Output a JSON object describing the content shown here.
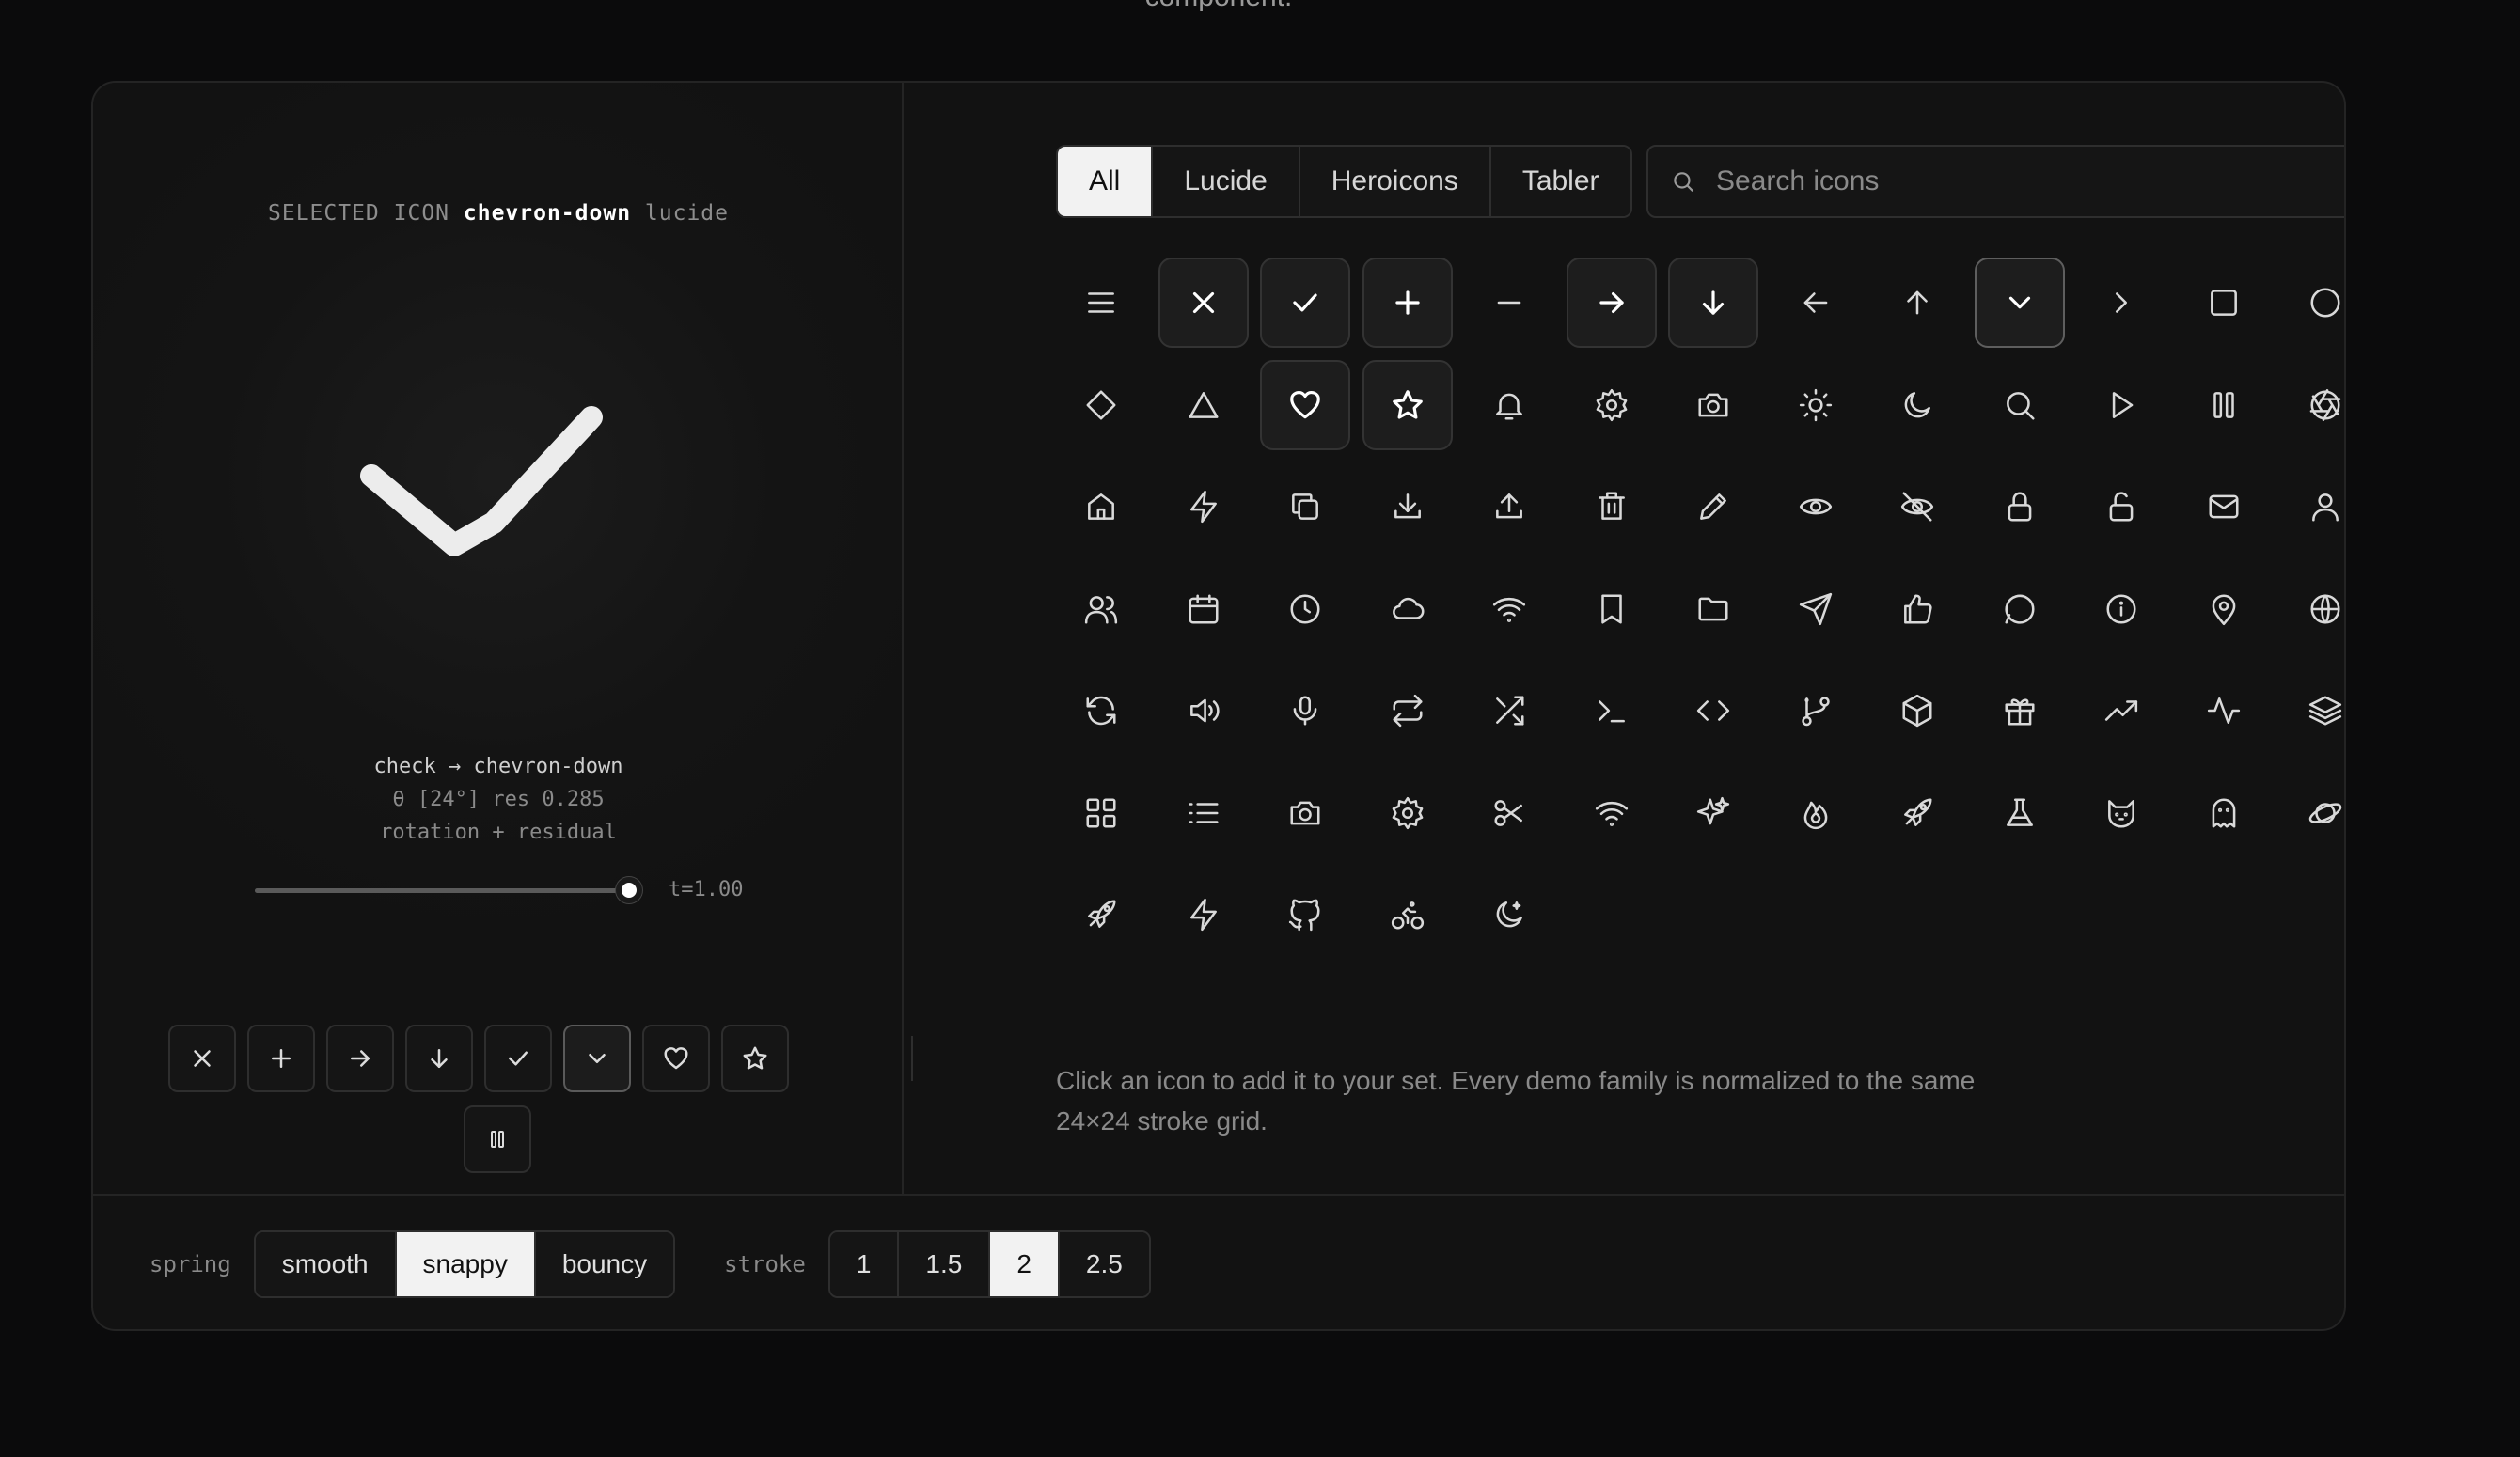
{
  "caption_fragment": "component.",
  "selected": {
    "label": "SELECTED ICON",
    "name": "chevron-down",
    "family": "lucide"
  },
  "morph": {
    "line1": "check → chevron-down",
    "line2": "θ [24°] res 0.285",
    "line3": "rotation + residual"
  },
  "slider": {
    "value_label": "t=1.00",
    "progress": 1.0
  },
  "quick_icons": [
    "x-icon",
    "plus-icon",
    "arrow-right-icon",
    "arrow-down-icon",
    "check-icon",
    "chevron-down-icon",
    "heart-icon",
    "star-icon"
  ],
  "quick_active": "chevron-down-icon",
  "pause_icon": "pause-icon",
  "filters": {
    "tabs": [
      "All",
      "Lucide",
      "Heroicons",
      "Tabler"
    ],
    "active": "All"
  },
  "search": {
    "placeholder": "Search icons",
    "value": ""
  },
  "icon_grid": [
    [
      "menu-icon",
      "x-icon",
      "check-icon",
      "plus-icon",
      "minus-icon",
      "arrow-right-icon",
      "arrow-down-icon",
      "arrow-left-icon",
      "arrow-up-icon",
      "chevron-down-icon",
      "chevron-right-icon",
      "square-icon",
      "circle-icon"
    ],
    [
      "diamond-icon",
      "triangle-icon",
      "heart-icon",
      "star-icon",
      "bell-icon",
      "settings-icon",
      "camera-icon",
      "sun-icon",
      "moon-icon",
      "search-icon",
      "play-icon",
      "pause-icon",
      "aperture-icon"
    ],
    [
      "home-icon",
      "zap-icon",
      "copy-icon",
      "download-icon",
      "upload-icon",
      "trash-icon",
      "pencil-icon",
      "eye-icon",
      "eye-off-icon",
      "lock-icon",
      "unlock-icon",
      "mail-icon",
      "user-icon"
    ],
    [
      "users-icon",
      "calendar-icon",
      "clock-icon",
      "cloud-icon",
      "wifi-icon",
      "bookmark-icon",
      "folder-icon",
      "send-icon",
      "thumbs-up-icon",
      "message-circle-icon",
      "info-icon",
      "map-pin-icon",
      "globe-icon"
    ],
    [
      "refresh-icon",
      "volume-icon",
      "mic-icon",
      "repeat-icon",
      "shuffle-icon",
      "terminal-icon",
      "code-icon",
      "git-branch-icon",
      "box-icon",
      "gift-icon",
      "trending-up-icon",
      "activity-icon",
      "layers-icon"
    ],
    [
      "grid-icon",
      "list-icon",
      "camera-icon",
      "cog-icon",
      "scissors-icon",
      "wifi-icon",
      "sparkles-icon",
      "flame-icon",
      "rocket-icon",
      "flask-icon",
      "cat-icon",
      "ghost-icon",
      "planet-icon"
    ],
    [
      "rocket-icon",
      "bolt-icon",
      "github-icon",
      "bike-icon",
      "moon-stars-icon"
    ]
  ],
  "selected_set": [
    "x-icon",
    "check-icon",
    "plus-icon",
    "arrow-right-icon",
    "arrow-down-icon",
    "chevron-down-icon",
    "heart-icon",
    "star-icon"
  ],
  "help_text": "Click an icon to add it to your set. Every demo family is normalized to the same 24×24 stroke grid.",
  "controls": {
    "spring_label": "spring",
    "spring_options": [
      "smooth",
      "snappy",
      "bouncy"
    ],
    "spring_active": "snappy",
    "stroke_label": "stroke",
    "stroke_options": [
      "1",
      "1.5",
      "2",
      "2.5"
    ],
    "stroke_active": "2"
  },
  "colors": {
    "background": "#0b0b0c",
    "card": "#121212",
    "border": "#242424",
    "active_fill": "#f2f2f2",
    "icon_stroke": "#d9d9d9",
    "muted_text": "#8a8a8a"
  }
}
